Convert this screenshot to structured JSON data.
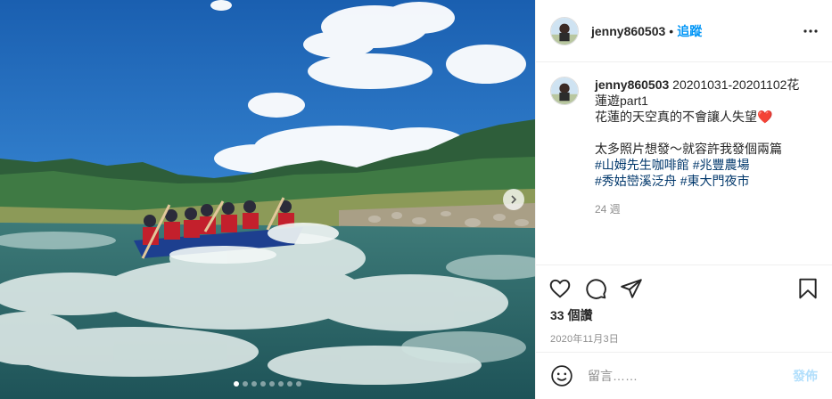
{
  "post": {
    "username": "jenny860503",
    "separator": "•",
    "follow_label": "追蹤",
    "more_icon": "more-horizontal-icon",
    "next_icon": "chevron-right-icon",
    "carousel": {
      "count": 8,
      "active_index": 0
    }
  },
  "caption": {
    "username": "jenny860503",
    "title_part1": " 20201031-20201102花",
    "title_part2": "蓮遊part1",
    "line2": "花蓮的天空真的不會讓人失望",
    "heart_emoji": "❤️",
    "line3": "太多照片想發～就容許我發個兩篇",
    "tags_line1": [
      "#山姆先生咖啡館",
      "#兆豐農場"
    ],
    "tags_line2": [
      "#秀姑巒溪泛舟",
      "#東大門夜市"
    ],
    "time_ago": "24 週"
  },
  "actions": {
    "like_icon": "heart-icon",
    "comment_icon": "comment-icon",
    "share_icon": "share-icon",
    "save_icon": "bookmark-icon"
  },
  "likes_text": "33 個讚",
  "date_text": "2020年11月3日",
  "comment_box": {
    "emoji_icon": "smiley-icon",
    "placeholder": "留言……",
    "post_label": "發佈"
  },
  "colors": {
    "link": "#0095f6",
    "hashtag": "#00376b",
    "muted": "#8e8e8e",
    "post_disabled": "#b2dffc",
    "heart": "#ed4956"
  }
}
